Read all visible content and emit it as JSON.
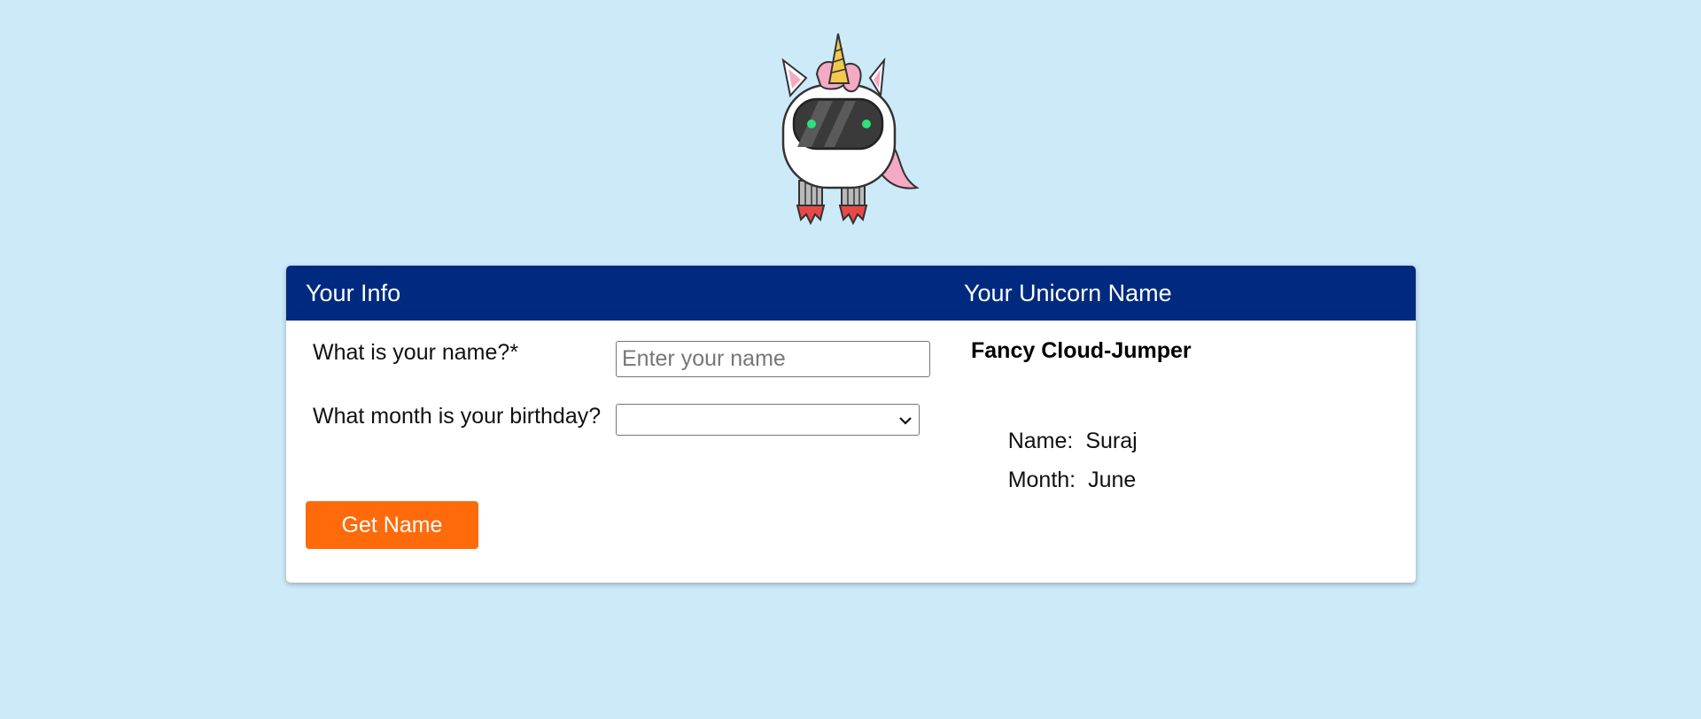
{
  "mascot": {
    "icon": "unicorn-robot-mascot"
  },
  "card": {
    "left_title": "Your Info",
    "right_title": "Your Unicorn Name",
    "header_color": "#002a80"
  },
  "form": {
    "name_question": "What is your name?*",
    "name_placeholder": "Enter your name",
    "name_value": "",
    "month_question": "What month is your birthday?",
    "month_selected": "",
    "submit_label": "Get Name",
    "button_color": "#ff6a0a"
  },
  "result": {
    "unicorn_name": "Fancy Cloud-Jumper",
    "name_label": "Name:",
    "name_value": "Suraj",
    "month_label": "Month:",
    "month_value": "June"
  }
}
